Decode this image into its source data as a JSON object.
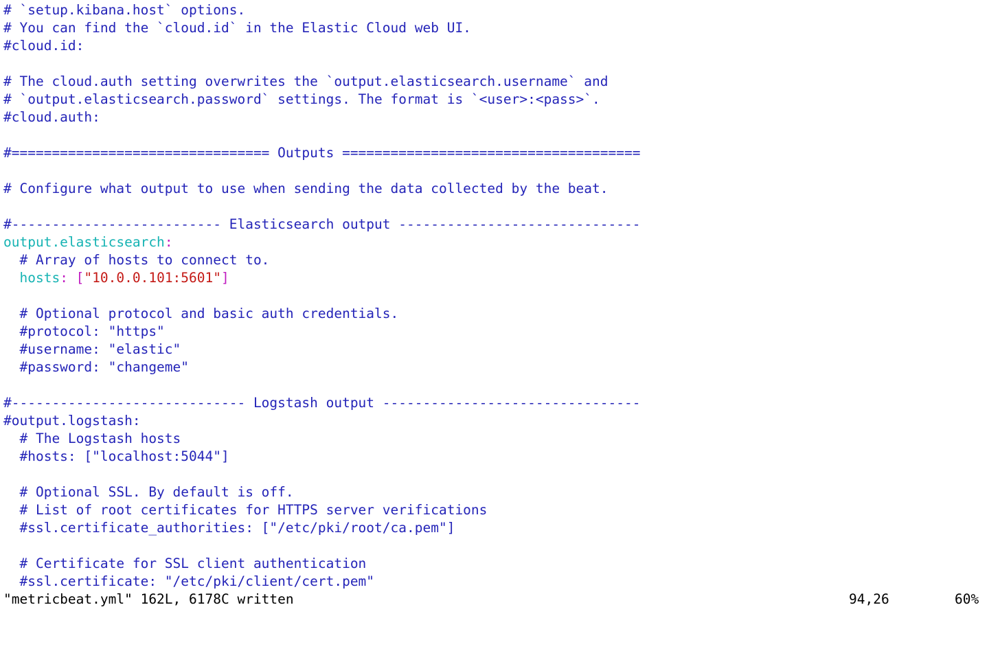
{
  "editor": {
    "file_name": "metricbeat.yml",
    "lines": {
      "l01": "# `setup.kibana.host` options.",
      "l02": "# You can find the `cloud.id` in the Elastic Cloud web UI.",
      "l03": "#cloud.id:",
      "l04": "",
      "l05": "# The cloud.auth setting overwrites the `output.elasticsearch.username` and",
      "l06": "# `output.elasticsearch.password` settings. The format is `<user>:<pass>`.",
      "l07": "#cloud.auth:",
      "l08": "",
      "l09": "#================================ Outputs =====================================",
      "l10": "",
      "l11": "# Configure what output to use when sending the data collected by the beat.",
      "l12": "",
      "l13": "#-------------------------- Elasticsearch output ------------------------------",
      "l14_key": "output.elasticsearch",
      "l14_colon": ":",
      "l15": "  # Array of hosts to connect to.",
      "l16_indent": "  ",
      "l16_key": "hosts",
      "l16_colon": ": ",
      "l16_open": "[",
      "l16_value": "\"10.0.0.101:5601\"",
      "l16_close": "]",
      "l17": "",
      "l18": "  # Optional protocol and basic auth credentials.",
      "l19": "  #protocol: \"https\"",
      "l20": "  #username: \"elastic\"",
      "l21": "  #password: \"changeme\"",
      "l22": "",
      "l23": "#----------------------------- Logstash output --------------------------------",
      "l24": "#output.logstash:",
      "l25": "  # The Logstash hosts",
      "l26": "  #hosts: [\"localhost:5044\"]",
      "l27": "",
      "l28": "  # Optional SSL. By default is off.",
      "l29": "  # List of root certificates for HTTPS server verifications",
      "l30": "  #ssl.certificate_authorities: [\"/etc/pki/root/ca.pem\"]",
      "l31": "",
      "l32": "  # Certificate for SSL client authentication",
      "l33": "  #ssl.certificate: \"/etc/pki/client/cert.pem\""
    }
  },
  "status_bar": {
    "message": "\"metricbeat.yml\" 162L, 6178C written",
    "cursor_position": "94,26",
    "scroll_percent": "60%"
  },
  "colors": {
    "comment": "#2424b8",
    "yaml_key": "#16b3b3",
    "bracket": "#c01ac0",
    "string": "#c41a16",
    "background": "#ffffff"
  }
}
